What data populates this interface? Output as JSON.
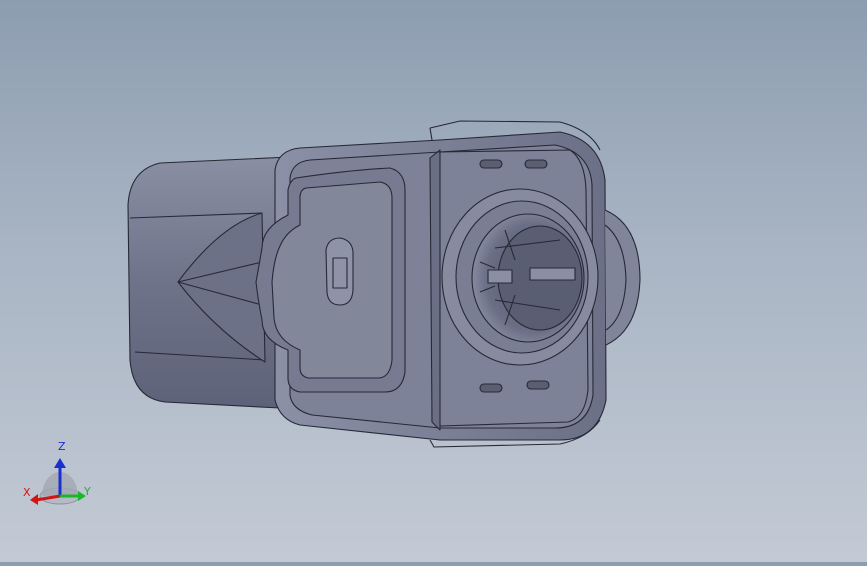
{
  "viewport": {
    "model": "connector-housing-model"
  },
  "triad": {
    "x_label": "X",
    "y_label": "Y",
    "z_label": "Z",
    "x_color": "#d01515",
    "y_color": "#18b82a",
    "z_color": "#1a2fd0"
  },
  "colors": {
    "background_top": "#8d9db0",
    "background_bottom": "#c3cad5",
    "part_fill": "#7a7f94",
    "part_edge": "#262936"
  }
}
